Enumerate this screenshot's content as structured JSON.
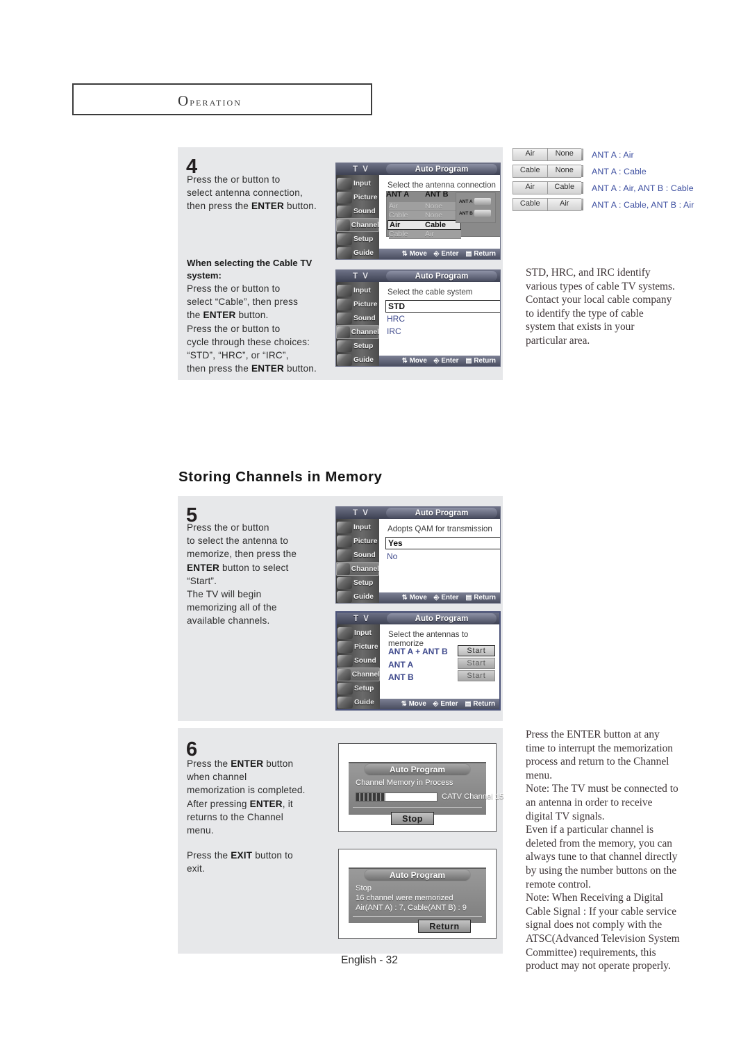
{
  "header": {
    "chapter": "OPERATION"
  },
  "step4": {
    "number": "4",
    "line1": "Press the      or      button to",
    "line2": "select antenna connection,",
    "line3_a": "then press the ",
    "line3_b": "ENTER",
    "line3_c": " button.",
    "subhead_line1": "When selecting the Cable TV",
    "subhead_line2": "system:",
    "b_line1": "Press the      or      button to",
    "b_line2": "select “Cable”, then press",
    "b_line3_a": "the ",
    "b_line3_b": "ENTER",
    "b_line3_c": " button.",
    "b_line4": "Press the      or      button to",
    "b_line5": "cycle through these choices:",
    "b_line6": "“STD”, “HRC”, or “IRC”,",
    "b_line7_a": "then press the ",
    "b_line7_b": "ENTER",
    "b_line7_c": " button."
  },
  "osd_common": {
    "tv_label": "T V",
    "title": "Auto Program",
    "menu": [
      "Input",
      "Picture",
      "Sound",
      "Channel",
      "Setup",
      "Guide"
    ],
    "selected_menu": "Channel",
    "footer": {
      "move": "Move",
      "enter": "Enter",
      "return": "Return"
    }
  },
  "osd_antenna": {
    "prompt": "Select the antenna connection",
    "col_a": "ANT A",
    "col_b": "ANT B",
    "rows": [
      {
        "a": "Air",
        "b": "None",
        "selected": false
      },
      {
        "a": "Cable",
        "b": "None",
        "selected": false
      },
      {
        "a": "Air",
        "b": "Cable",
        "selected": true
      },
      {
        "a": "Cable",
        "b": "Air",
        "selected": false
      }
    ],
    "thumb_a": "ANT A",
    "thumb_b": "ANT B"
  },
  "osd_cable": {
    "prompt": "Select the cable system",
    "options": [
      "STD",
      "HRC",
      "IRC"
    ],
    "selected": "STD"
  },
  "osd_qam": {
    "prompt": "Adopts QAM for transmission",
    "options": [
      "Yes",
      "No"
    ],
    "selected": "Yes"
  },
  "osd_memorize": {
    "prompt": "Select the antennas to memorize",
    "rows": [
      {
        "label": "ANT A + ANT B",
        "button": "Start",
        "active": true
      },
      {
        "label": "ANT A",
        "button": "Start",
        "active": false
      },
      {
        "label": "ANT B",
        "button": "Start",
        "active": false
      }
    ]
  },
  "antenna_table": {
    "rows": [
      {
        "a": "Air",
        "b": "None",
        "desc": "ANT A : Air"
      },
      {
        "a": "Cable",
        "b": "None",
        "desc": "ANT A : Cable"
      },
      {
        "a": "Air",
        "b": "Cable",
        "desc": "ANT A : Air, ANT B : Cable"
      },
      {
        "a": "Cable",
        "b": "Air",
        "desc": "ANT A : Cable, ANT B : Air"
      }
    ],
    "link_color": "#3d4fa0"
  },
  "note_std": "STD, HRC, and IRC identify various types of cable TV systems. Contact your local cable company to identify the type of cable system that exists in your particular area.",
  "section": {
    "title": "Storing Channels in Memory"
  },
  "step5": {
    "number": "5",
    "line1": "Press the      or      button",
    "line2": "to select the antenna to",
    "line3": "memorize, then press the",
    "line4_a": "ENTER",
    "line4_b": " button to select",
    "line5": "“Start”.",
    "line6": "The TV will begin",
    "line7": "memorizing all of the",
    "line8": "available channels."
  },
  "step6": {
    "number": "6",
    "line1_a": "Press the ",
    "line1_b": "ENTER",
    "line1_c": " button",
    "line2": "when channel",
    "line3": "memorization is completed.",
    "line4_a": "After pressing ",
    "line4_b": "ENTER",
    "line4_c": ", it",
    "line5": "returns to the Channel",
    "line6": "menu.",
    "line7_a": "Press the ",
    "line7_b": "EXIT",
    "line7_c": " button to",
    "line8": "exit."
  },
  "dialog_progress": {
    "title": "Auto Program",
    "status": "Channel Memory in Process",
    "channel": "CATV Channel 15",
    "button": "Stop",
    "progress_percent": 36
  },
  "dialog_done": {
    "title": "Auto Program",
    "line1": "Stop",
    "line2": "16 channel were memorized",
    "line3": "Air(ANT A) : 7, Cable(ANT B) : 9",
    "button": "Return"
  },
  "right_notes": {
    "p1": "Press the ENTER button at any time to interrupt the memorization process and return to the Channel menu.",
    "p2": "Note: The TV must be connected to an antenna in order to receive digital TV signals.",
    "p3": "Even if a particular channel is deleted from the memory, you can always tune to that channel directly by using the number buttons on the remote control.",
    "p4": "Note: When Receiving a Digital Cable Signal : If your cable service signal does not comply with the ATSC(Advanced Television System Committee) requirements, this product may not operate properly."
  },
  "footer": {
    "page": "English - 32"
  }
}
